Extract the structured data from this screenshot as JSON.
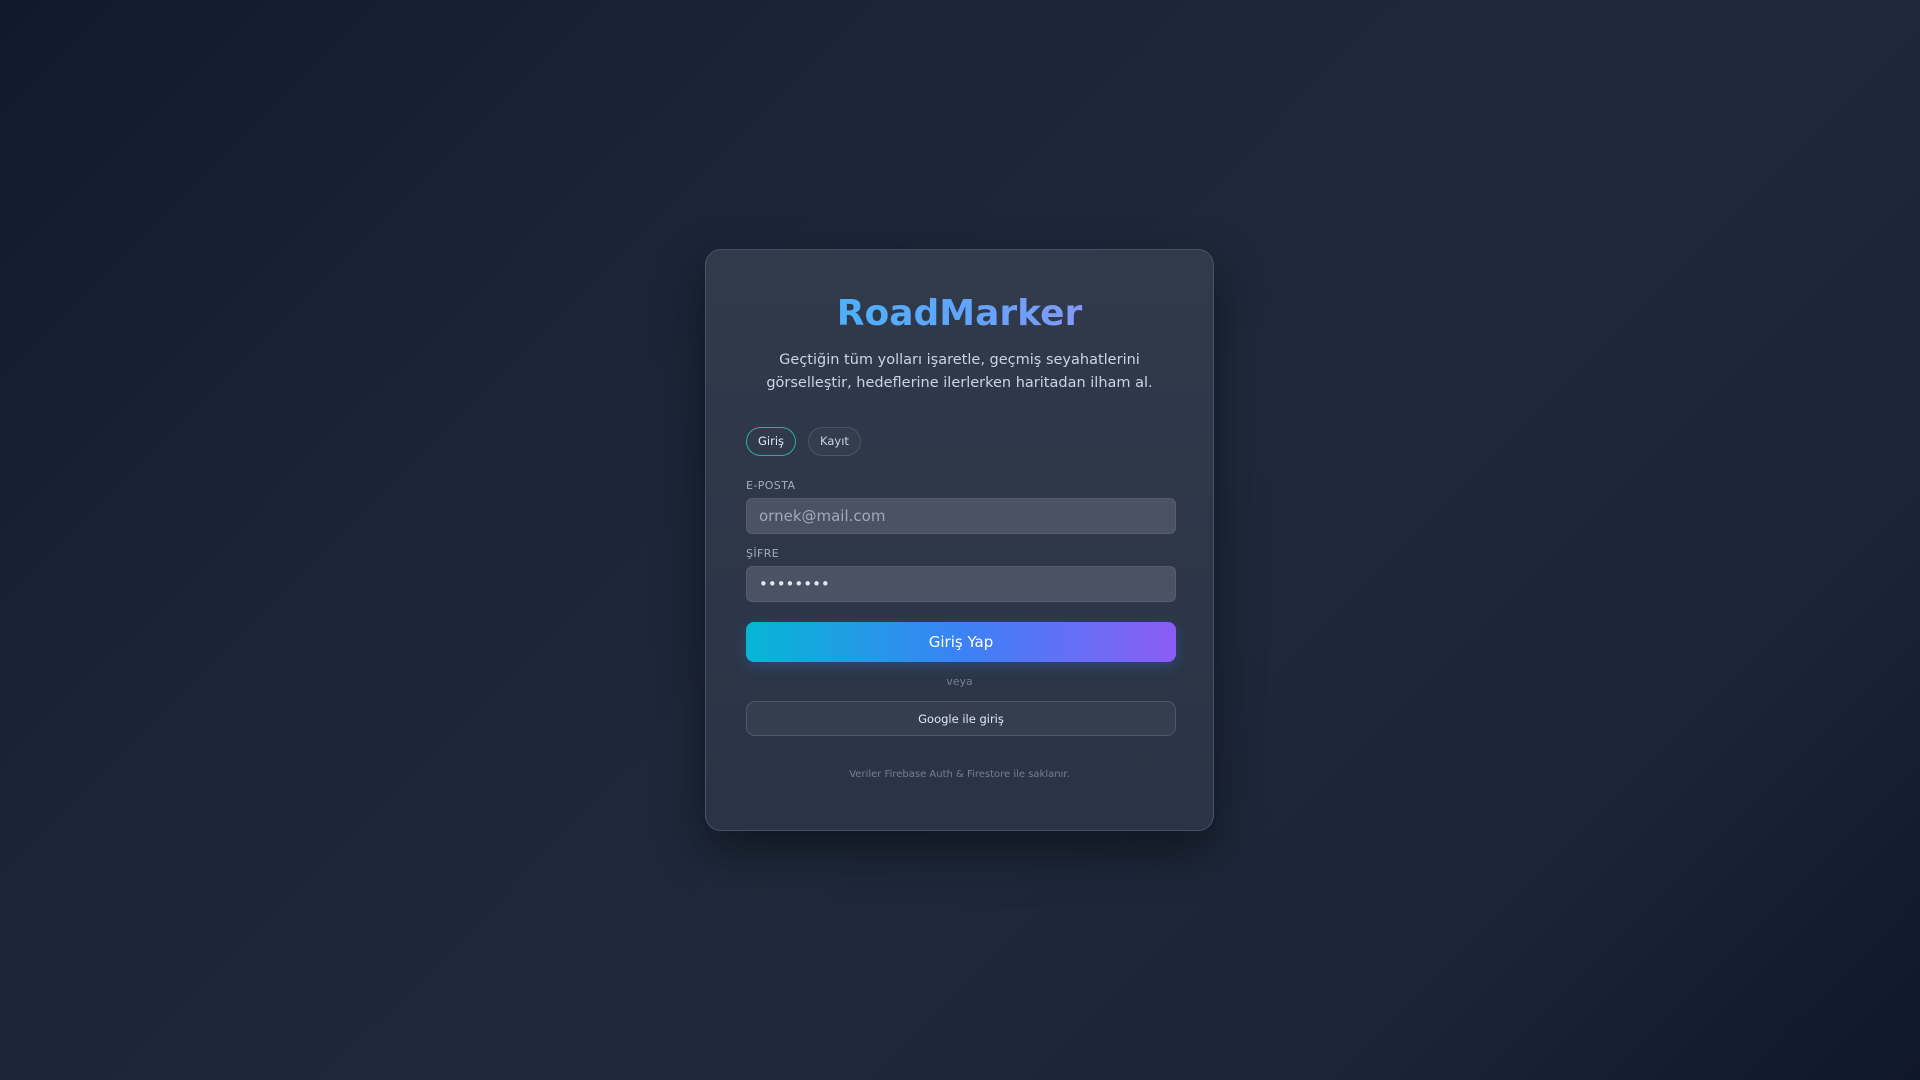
{
  "app": {
    "title": "RoadMarker",
    "subtitle": "Geçtiğin tüm yolları işaretle, geçmiş seyahatlerini görselleştir, hedeflerine ilerlerken haritadan ilham al."
  },
  "tabs": [
    {
      "label": "Giriş",
      "active": true
    },
    {
      "label": "Kayıt",
      "active": false
    }
  ],
  "form": {
    "email_label": "E-POSTA",
    "email_placeholder": "ornek@mail.com",
    "email_value": "",
    "password_label": "ŞİFRE",
    "password_value": "••••••••",
    "submit_label": "Giriş Yap",
    "divider_text": "veya",
    "google_label": "Google ile giriş"
  },
  "footer": {
    "note": "Veriler Firebase Auth & Firestore ile saklanır."
  },
  "colors": {
    "accent_start": "#06b6d4",
    "accent_mid": "#3b82f6",
    "accent_end": "#8b5cf6",
    "card_bg": "#2d3748",
    "page_bg": "#1e293b"
  }
}
